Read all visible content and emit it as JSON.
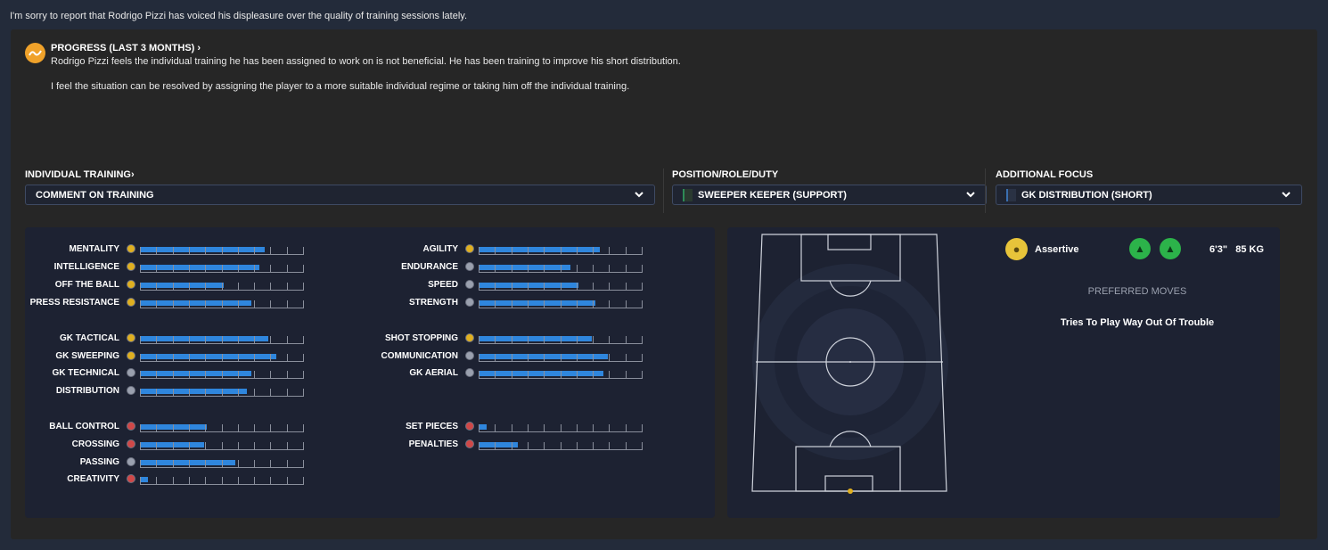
{
  "message": "I'm sorry to report that Rodrigo Pizzi has voiced his displeasure over the quality of training sessions lately.",
  "progress": {
    "title": "PROGRESS (LAST 3 MONTHS)",
    "chevron": "›",
    "line1": "Rodrigo Pizzi feels the individual training he has been assigned to work on is not beneficial. He has been training to improve his short distribution.",
    "line2": "I feel the situation can be resolved by assigning the player to a more suitable individual regime or taking him off the individual training."
  },
  "individual_training": {
    "label": "INDIVIDUAL TRAINING",
    "chevron": "›",
    "value": "COMMENT ON TRAINING"
  },
  "position_role": {
    "label": "POSITION/ROLE/DUTY",
    "value": "SWEEPER KEEPER (SUPPORT)",
    "swatch": "#2e8b57"
  },
  "additional_focus": {
    "label": "ADDITIONAL FOCUS",
    "value": "GK DISTRIBUTION (SHORT)",
    "swatch": "#3a6fb0"
  },
  "dropdown_icon": "chevron-down-icon",
  "attributes": {
    "left": [
      {
        "name": "MENTALITY",
        "value": 0.76,
        "dot": "#e0b020"
      },
      {
        "name": "INTELLIGENCE",
        "value": 0.73,
        "dot": "#e0b020"
      },
      {
        "name": "OFF THE BALL",
        "value": 0.51,
        "dot": "#e0b020"
      },
      {
        "name": "PRESS RESISTANCE",
        "value": 0.68,
        "dot": "#e0b020"
      },
      {
        "name": "GK TACTICAL",
        "value": 0.78,
        "dot": "#e0b020"
      },
      {
        "name": "GK SWEEPING",
        "value": 0.83,
        "dot": "#e0b020"
      },
      {
        "name": "GK TECHNICAL",
        "value": 0.68,
        "dot": "#9aa0ae"
      },
      {
        "name": "DISTRIBUTION",
        "value": 0.65,
        "dot": "#9aa0ae"
      },
      {
        "name": "BALL CONTROL",
        "value": 0.41,
        "dot": "#d04848"
      },
      {
        "name": "CROSSING",
        "value": 0.39,
        "dot": "#d04848"
      },
      {
        "name": "PASSING",
        "value": 0.58,
        "dot": "#9aa0ae"
      },
      {
        "name": "CREATIVITY",
        "value": 0.05,
        "dot": "#d04848"
      }
    ],
    "right": [
      {
        "name": "AGILITY",
        "value": 0.74,
        "dot": "#e0b020"
      },
      {
        "name": "ENDURANCE",
        "value": 0.56,
        "dot": "#9aa0ae"
      },
      {
        "name": "SPEED",
        "value": 0.61,
        "dot": "#9aa0ae"
      },
      {
        "name": "STRENGTH",
        "value": 0.71,
        "dot": "#9aa0ae"
      },
      {
        "name": "SHOT STOPPING",
        "value": 0.69,
        "dot": "#e0b020"
      },
      {
        "name": "COMMUNICATION",
        "value": 0.79,
        "dot": "#9aa0ae"
      },
      {
        "name": "GK AERIAL",
        "value": 0.76,
        "dot": "#9aa0ae"
      },
      {
        "name": "SET PIECES",
        "value": 0.05,
        "dot": "#d04848"
      },
      {
        "name": "PENALTIES",
        "value": 0.24,
        "dot": "#d04848"
      }
    ]
  },
  "player": {
    "trait": "Assertive",
    "trait_icon": "lightbulb-icon",
    "foot_icons": [
      "left-boot-icon",
      "right-boot-icon"
    ],
    "height_weight": "6'3\"   85 KG",
    "preferred_moves_label": "PREFERRED MOVES",
    "preferred_move": "Tries To Play Way Out Of Trouble"
  },
  "colors": {
    "accent": "#2f86dd",
    "progress_icon": "#f0a22a",
    "good": "#2cb34a"
  }
}
